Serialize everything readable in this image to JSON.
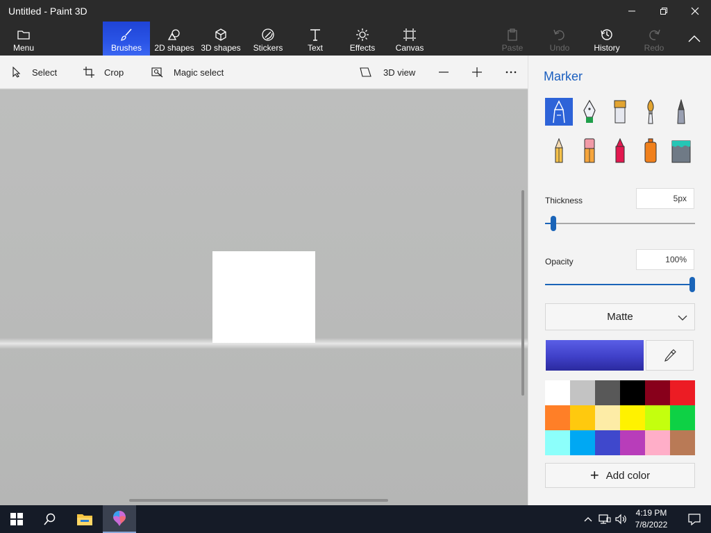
{
  "window": {
    "title": "Untitled - Paint 3D"
  },
  "ribbon": {
    "menu_label": "Menu",
    "tabs": [
      {
        "label": "Brushes",
        "icon": "brush-icon"
      },
      {
        "label": "2D shapes",
        "icon": "2d-shapes-icon"
      },
      {
        "label": "3D shapes",
        "icon": "3d-shapes-icon"
      },
      {
        "label": "Stickers",
        "icon": "stickers-icon"
      },
      {
        "label": "Text",
        "icon": "text-icon"
      },
      {
        "label": "Effects",
        "icon": "effects-icon"
      },
      {
        "label": "Canvas",
        "icon": "canvas-icon"
      }
    ],
    "active_tab": "Brushes",
    "actions": [
      {
        "label": "Paste",
        "enabled": false
      },
      {
        "label": "Undo",
        "enabled": false
      },
      {
        "label": "History",
        "enabled": true
      },
      {
        "label": "Redo",
        "enabled": false
      }
    ]
  },
  "toolbar": {
    "select_label": "Select",
    "crop_label": "Crop",
    "magic_select_label": "Magic select",
    "view3d_label": "3D view"
  },
  "panel": {
    "title": "Marker",
    "brushes": [
      "marker",
      "calligraphy-pen",
      "oil-brush",
      "watercolor",
      "pixel-pen",
      "pencil",
      "eraser",
      "crayon",
      "spray-can",
      "fill"
    ],
    "selected_brush": "marker",
    "thickness": {
      "label": "Thickness",
      "value": "5px",
      "level": 0.05
    },
    "opacity": {
      "label": "Opacity",
      "value": "100%",
      "level": 1.0
    },
    "finish": "Matte",
    "current_color": "#3f40c8",
    "palette": [
      "#ffffff",
      "#c3c3c3",
      "#585858",
      "#000000",
      "#88001b",
      "#ec1c24",
      "#ff7f27",
      "#ffc90e",
      "#fdeca6",
      "#fff200",
      "#c4ff0e",
      "#0ed145",
      "#8cfffb",
      "#00a8f3",
      "#3f48cc",
      "#b83dba",
      "#ffaec8",
      "#b97a56"
    ],
    "add_color_label": "Add color"
  },
  "taskbar": {
    "time": "4:19 PM",
    "date": "7/8/2022"
  }
}
